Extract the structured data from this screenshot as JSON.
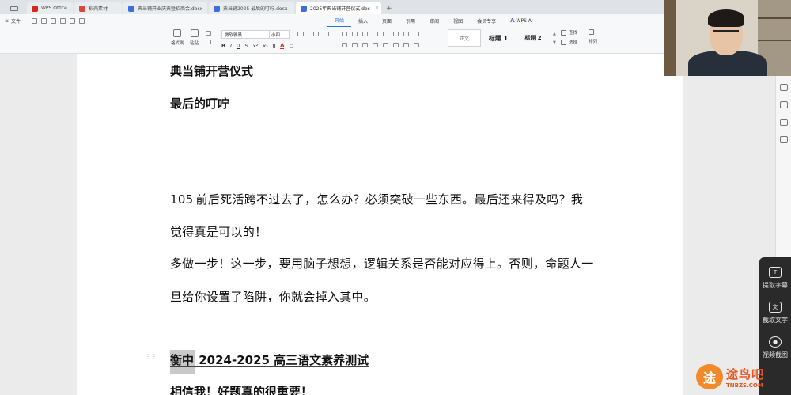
{
  "tabs": [
    {
      "label": "WPS Office",
      "color": "#d6281e",
      "active": false
    },
    {
      "label": "稻壳素材",
      "color": "#e0473a",
      "active": false
    },
    {
      "label": "典当铺开业庆典暨招商会.docx",
      "color": "#3a6fe0",
      "active": false
    },
    {
      "label": "典当铺2025 最后的叮咛.docx",
      "color": "#3a6fe0",
      "active": false
    },
    {
      "label": "2025年典当铺开营仪式.doc",
      "color": "#3a6fe0",
      "active": true
    }
  ],
  "menu": {
    "file_label": "文件",
    "tabs": [
      "开始",
      "插入",
      "页面",
      "引用",
      "审阅",
      "视图",
      "会员专享"
    ],
    "active_tab": "开始",
    "wps_ai_label": "WPS AI"
  },
  "toolbar": {
    "format_painter": "格式刷",
    "paste": "粘贴",
    "font_name": "微软雅黑",
    "font_size": "小四",
    "style_normal": "正文",
    "style_h1": "标题 1",
    "style_h2": "标题 2",
    "find_replace": "查找",
    "select": "选择",
    "sort": "排列"
  },
  "document": {
    "line1": "典当铺开营仪式",
    "line2": "最后的叮咛",
    "para1_prefix": "105",
    "para1_rest": "前后死活跨不过去了，怎么办？必须突破一些东西。最后还来得及吗？我",
    "para1_line2": "觉得真是可以的！",
    "para2_line1": "多做一步！这一步，要用脑子想想，逻辑关系是否能对应得上。否则，命题人一",
    "para2_line2": "旦给你设置了陷阱，你就会掉入其中。",
    "section_highlight": "衡中",
    "section_rest": " 2024-2025 高三语文素养测试",
    "last_line": "相信我！好题真的很重要！"
  },
  "side_panel": {
    "extract_subtitles": "提取字幕",
    "extract_text": "截取文字",
    "video_screenshot": "视频截图"
  },
  "watermark": {
    "logo_char": "途",
    "main": "途鸟吧",
    "sub": "TNBZS.COM"
  }
}
